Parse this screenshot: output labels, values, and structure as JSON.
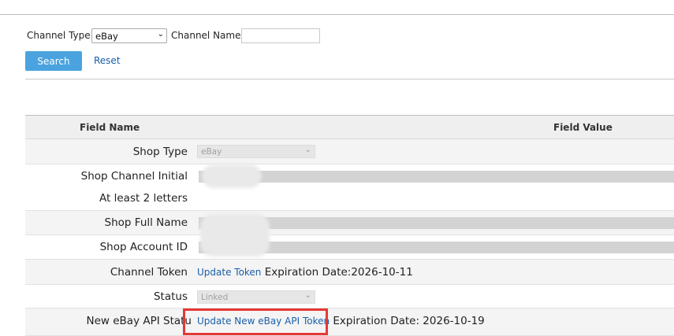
{
  "filters": {
    "channel_type_label": "Channel Type",
    "channel_type_value": "eBay",
    "channel_name_label": "Channel Name",
    "channel_name_value": "",
    "search_label": "Search",
    "reset_label": "Reset"
  },
  "table": {
    "header_field_name": "Field Name",
    "header_field_value": "Field Value",
    "rows": {
      "shop_type": {
        "label": "Shop Type",
        "value": "eBay"
      },
      "shop_channel_initial": {
        "label": "Shop Channel Initial",
        "hint": "At least 2 letters"
      },
      "shop_full_name": {
        "label": "Shop Full Name"
      },
      "shop_account_id": {
        "label": "Shop Account ID"
      },
      "channel_token": {
        "label": "Channel Token",
        "link": "Update Token",
        "expiration": "Expiration Date:2026-10-11"
      },
      "status": {
        "label": "Status",
        "value": "Linked"
      },
      "new_ebay_api": {
        "label": "New eBay API Statu",
        "link": "Update New eBay API Token",
        "expiration": "Expiration Date: 2026-10-19"
      }
    }
  },
  "colors": {
    "accent_button": "#4aa3df",
    "link": "#1a5fa8",
    "highlight_border": "#e53935"
  },
  "icons": {
    "dropdown": "chevron-down-icon"
  }
}
